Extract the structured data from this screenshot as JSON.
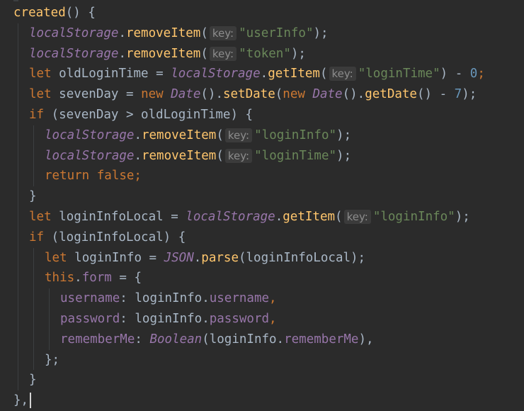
{
  "editor": {
    "language": "javascript",
    "lines": [
      {
        "indent": 0,
        "tokens": [
          {
            "t": "created",
            "c": "fn"
          },
          {
            "t": "() {",
            "c": "plain"
          }
        ]
      },
      {
        "indent": 1,
        "tokens": [
          {
            "t": "localStorage",
            "c": "global"
          },
          {
            "t": ".",
            "c": "plain"
          },
          {
            "t": "removeItem",
            "c": "fn"
          },
          {
            "t": "(",
            "c": "plain"
          },
          {
            "t": "key:",
            "c": "hint"
          },
          {
            "t": "\"userInfo\"",
            "c": "str"
          },
          {
            "t": ");",
            "c": "plain"
          }
        ]
      },
      {
        "indent": 1,
        "tokens": [
          {
            "t": "localStorage",
            "c": "global"
          },
          {
            "t": ".",
            "c": "plain"
          },
          {
            "t": "removeItem",
            "c": "fn"
          },
          {
            "t": "(",
            "c": "plain"
          },
          {
            "t": "key:",
            "c": "hint"
          },
          {
            "t": "\"token\"",
            "c": "str"
          },
          {
            "t": ");",
            "c": "plain"
          }
        ]
      },
      {
        "indent": 1,
        "tokens": [
          {
            "t": "let ",
            "c": "kw"
          },
          {
            "t": "oldLoginTime = ",
            "c": "plain"
          },
          {
            "t": "localStorage",
            "c": "global"
          },
          {
            "t": ".",
            "c": "plain"
          },
          {
            "t": "getItem",
            "c": "fn"
          },
          {
            "t": "(",
            "c": "plain"
          },
          {
            "t": "key:",
            "c": "hint"
          },
          {
            "t": "\"loginTime\"",
            "c": "str"
          },
          {
            "t": ") - ",
            "c": "plain"
          },
          {
            "t": "0",
            "c": "num"
          },
          {
            "t": ";",
            "c": "kw"
          }
        ]
      },
      {
        "indent": 1,
        "tokens": [
          {
            "t": "let ",
            "c": "kw"
          },
          {
            "t": "sevenDay = ",
            "c": "plain"
          },
          {
            "t": "new ",
            "c": "kw"
          },
          {
            "t": "Date",
            "c": "global"
          },
          {
            "t": "().",
            "c": "plain"
          },
          {
            "t": "setDate",
            "c": "fn"
          },
          {
            "t": "(",
            "c": "plain"
          },
          {
            "t": "new ",
            "c": "kw"
          },
          {
            "t": "Date",
            "c": "global"
          },
          {
            "t": "().",
            "c": "plain"
          },
          {
            "t": "getDate",
            "c": "fn"
          },
          {
            "t": "() - ",
            "c": "plain"
          },
          {
            "t": "7",
            "c": "num"
          },
          {
            "t": ");",
            "c": "plain"
          }
        ]
      },
      {
        "indent": 1,
        "tokens": [
          {
            "t": "if ",
            "c": "kw"
          },
          {
            "t": "(sevenDay > oldLoginTime) {",
            "c": "plain"
          }
        ]
      },
      {
        "indent": 2,
        "tokens": [
          {
            "t": "localStorage",
            "c": "global"
          },
          {
            "t": ".",
            "c": "plain"
          },
          {
            "t": "removeItem",
            "c": "fn"
          },
          {
            "t": "(",
            "c": "plain"
          },
          {
            "t": "key:",
            "c": "hint"
          },
          {
            "t": "\"loginInfo\"",
            "c": "str"
          },
          {
            "t": ");",
            "c": "plain"
          }
        ]
      },
      {
        "indent": 2,
        "tokens": [
          {
            "t": "localStorage",
            "c": "global"
          },
          {
            "t": ".",
            "c": "plain"
          },
          {
            "t": "removeItem",
            "c": "fn"
          },
          {
            "t": "(",
            "c": "plain"
          },
          {
            "t": "key:",
            "c": "hint"
          },
          {
            "t": "\"loginTime\"",
            "c": "str"
          },
          {
            "t": ");",
            "c": "plain"
          }
        ]
      },
      {
        "indent": 2,
        "tokens": [
          {
            "t": "return false;",
            "c": "kw"
          }
        ]
      },
      {
        "indent": 1,
        "tokens": [
          {
            "t": "}",
            "c": "plain"
          }
        ]
      },
      {
        "indent": 1,
        "tokens": [
          {
            "t": "let ",
            "c": "kw"
          },
          {
            "t": "loginInfoLocal = ",
            "c": "plain"
          },
          {
            "t": "localStorage",
            "c": "global"
          },
          {
            "t": ".",
            "c": "plain"
          },
          {
            "t": "getItem",
            "c": "fn"
          },
          {
            "t": "(",
            "c": "plain"
          },
          {
            "t": "key:",
            "c": "hint"
          },
          {
            "t": "\"loginInfo\"",
            "c": "str"
          },
          {
            "t": ");",
            "c": "plain"
          }
        ]
      },
      {
        "indent": 1,
        "tokens": [
          {
            "t": "if ",
            "c": "kw"
          },
          {
            "t": "(loginInfoLocal) {",
            "c": "plain"
          }
        ]
      },
      {
        "indent": 2,
        "tokens": [
          {
            "t": "let ",
            "c": "kw"
          },
          {
            "t": "loginInfo = ",
            "c": "plain"
          },
          {
            "t": "JSON",
            "c": "global"
          },
          {
            "t": ".",
            "c": "plain"
          },
          {
            "t": "parse",
            "c": "fn"
          },
          {
            "t": "(loginInfoLocal);",
            "c": "plain"
          }
        ]
      },
      {
        "indent": 2,
        "tokens": [
          {
            "t": "this",
            "c": "kw"
          },
          {
            "t": ".",
            "c": "plain"
          },
          {
            "t": "form",
            "c": "prop"
          },
          {
            "t": " = {",
            "c": "plain"
          }
        ]
      },
      {
        "indent": 3,
        "tokens": [
          {
            "t": "username",
            "c": "prop"
          },
          {
            "t": ": loginInfo.",
            "c": "plain"
          },
          {
            "t": "username",
            "c": "prop"
          },
          {
            "t": ",",
            "c": "kw"
          }
        ]
      },
      {
        "indent": 3,
        "tokens": [
          {
            "t": "password",
            "c": "prop"
          },
          {
            "t": ": loginInfo.",
            "c": "plain"
          },
          {
            "t": "password",
            "c": "prop"
          },
          {
            "t": ",",
            "c": "kw"
          }
        ]
      },
      {
        "indent": 3,
        "tokens": [
          {
            "t": "rememberMe",
            "c": "prop"
          },
          {
            "t": ": ",
            "c": "plain"
          },
          {
            "t": "Boolean",
            "c": "global"
          },
          {
            "t": "(loginInfo.",
            "c": "plain"
          },
          {
            "t": "rememberMe",
            "c": "prop"
          },
          {
            "t": "),",
            "c": "plain"
          }
        ]
      },
      {
        "indent": 2,
        "tokens": [
          {
            "t": "};",
            "c": "plain"
          }
        ]
      },
      {
        "indent": 1,
        "tokens": [
          {
            "t": "}",
            "c": "plain"
          }
        ]
      },
      {
        "indent": 0,
        "tokens": [
          {
            "t": "},",
            "c": "plain"
          }
        ],
        "caret": true
      }
    ]
  },
  "colors": {
    "background": "#2b2b2b",
    "plain": "#a9b7c6",
    "function": "#ffc66d",
    "keyword": "#cc7832",
    "string": "#6a8759",
    "number": "#6897bb",
    "global": "#9876aa",
    "hint": "#8c8c8c"
  }
}
